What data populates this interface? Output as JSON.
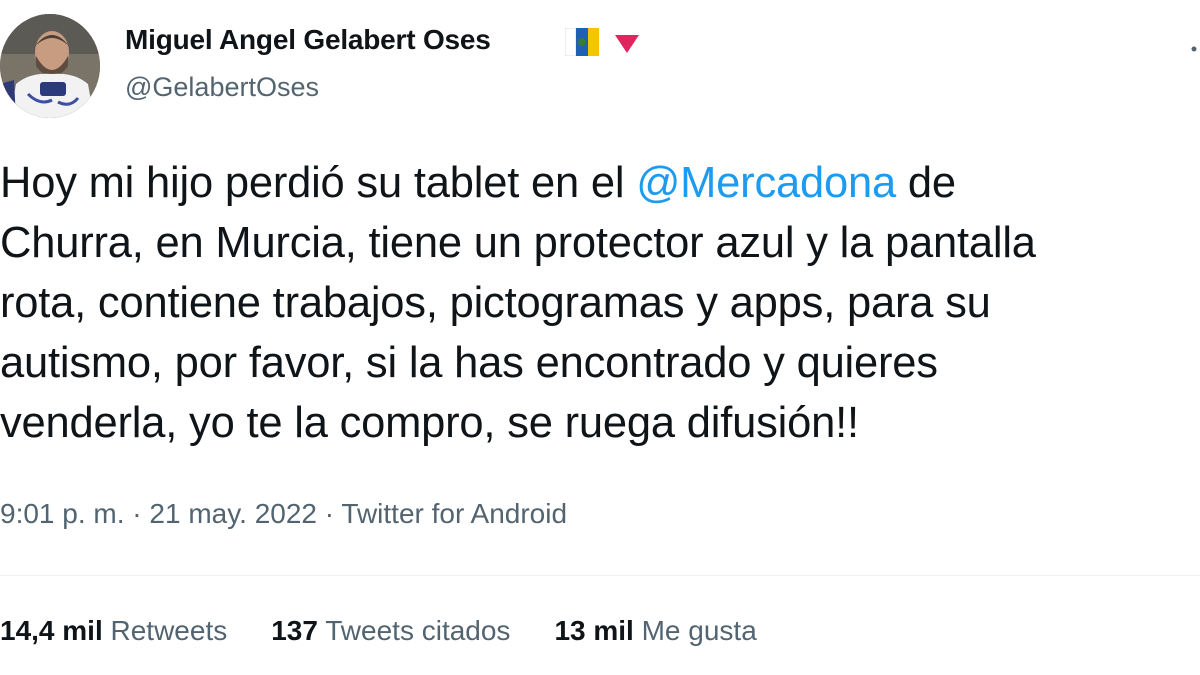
{
  "author": {
    "display_name": "Miguel Angel Gelabert Oses",
    "handle": "@GelabertOses",
    "flag_icon": "canary-islands-flag-icon",
    "badge_icon": "red-triangle-icon",
    "badge_color": "#e0245e"
  },
  "tweet": {
    "lines": [
      {
        "text_before": "Hoy mi hijo perdió su tablet en el ",
        "mention": "@Mercadona",
        "text_after": " de"
      },
      {
        "text": "Churra, en Murcia, tiene un protector azul y la pantalla"
      },
      {
        "text": "rota, contiene trabajos, pictogramas y apps, para su"
      },
      {
        "text": "autismo, por favor, si la has encontrado y quieres"
      },
      {
        "text": "venderla, yo te la compro, se ruega difusión!!"
      }
    ],
    "mention_color": "#1d9bf0"
  },
  "meta": {
    "time": "9:01 p. m.",
    "separator": " · ",
    "date": "21 may. 2022",
    "source": "Twitter for Android"
  },
  "stats": {
    "retweets": {
      "count": "14,4 mil",
      "label": "Retweets"
    },
    "quotes": {
      "count": "137",
      "label": "Tweets citados"
    },
    "likes": {
      "count": "13 mil",
      "label": "Me gusta"
    }
  }
}
